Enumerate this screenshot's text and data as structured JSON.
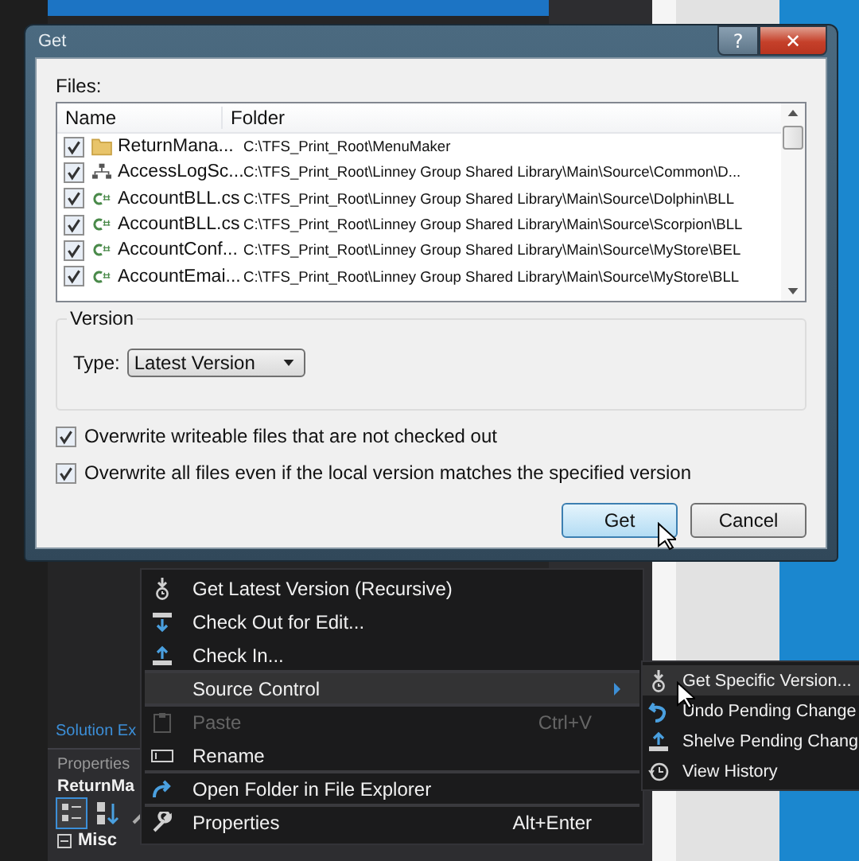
{
  "background": {
    "solution_tab": "Solution Ex",
    "properties_title": "Properties",
    "properties_object": "ReturnMa",
    "properties_category": "Misc"
  },
  "dialog": {
    "title": "Get",
    "help_button": "?",
    "close_button": "✕",
    "files_label": "Files:",
    "columns": [
      "Name",
      "Folder"
    ],
    "files": [
      {
        "name": "ReturnMana...",
        "folder": "C:\\TFS_Print_Root\\MenuMaker",
        "checked": true,
        "kind": "folder"
      },
      {
        "name": "AccessLogSc...",
        "folder": "C:\\TFS_Print_Root\\Linney Group Shared Library\\Main\\Source\\Common\\D...",
        "checked": true,
        "kind": "diagram"
      },
      {
        "name": "AccountBLL.cs",
        "folder": "C:\\TFS_Print_Root\\Linney Group Shared Library\\Main\\Source\\Dolphin\\BLL",
        "checked": true,
        "kind": "code"
      },
      {
        "name": "AccountBLL.cs",
        "folder": "C:\\TFS_Print_Root\\Linney Group Shared Library\\Main\\Source\\Scorpion\\BLL",
        "checked": true,
        "kind": "code"
      },
      {
        "name": "AccountConf...",
        "folder": "C:\\TFS_Print_Root\\Linney Group Shared Library\\Main\\Source\\MyStore\\BEL",
        "checked": true,
        "kind": "code"
      },
      {
        "name": "AccountEmai...",
        "folder": "C:\\TFS_Print_Root\\Linney Group Shared Library\\Main\\Source\\MyStore\\BLL",
        "checked": true,
        "kind": "code"
      }
    ],
    "version_group": "Version",
    "type_label": "Type:",
    "type_value": "Latest Version",
    "options": [
      {
        "label": "Overwrite writeable files that are not checked out",
        "checked": true
      },
      {
        "label": "Overwrite all files even if the local version matches the specified version",
        "checked": true
      }
    ],
    "buttons": [
      {
        "label": "Get",
        "selected": true
      },
      {
        "label": "Cancel",
        "selected": false
      }
    ]
  },
  "context_menu": {
    "items": [
      {
        "label": "Get Latest Version (Recursive)",
        "kind": "get",
        "selected": false,
        "disabled": false,
        "submenu": false
      },
      {
        "label": "Check Out for Edit...",
        "kind": "checkout",
        "selected": false,
        "disabled": false,
        "submenu": false
      },
      {
        "label": "Check In...",
        "kind": "checkin",
        "selected": false,
        "disabled": false,
        "submenu": false,
        "separator_after": true
      },
      {
        "label": "Source Control",
        "kind": "none",
        "selected": true,
        "disabled": false,
        "submenu": true,
        "separator_after": true
      },
      {
        "label": "Paste",
        "shortcut": "Ctrl+V",
        "kind": "paste",
        "selected": false,
        "disabled": true,
        "submenu": false
      },
      {
        "label": "Rename",
        "kind": "rename",
        "selected": false,
        "disabled": false,
        "submenu": false,
        "separator_after": true
      },
      {
        "label": "Open Folder in File Explorer",
        "kind": "open",
        "selected": false,
        "disabled": false,
        "submenu": false,
        "separator_after": true
      },
      {
        "label": "Properties",
        "shortcut": "Alt+Enter",
        "kind": "wrench",
        "selected": false,
        "disabled": false,
        "submenu": false
      }
    ]
  },
  "submenu": {
    "items": [
      {
        "label": "Get Specific Version...",
        "kind": "get",
        "selected": true
      },
      {
        "label": "Undo Pending Change",
        "kind": "undo",
        "selected": false
      },
      {
        "label": "Shelve Pending Chang",
        "kind": "checkin",
        "selected": false
      },
      {
        "label": "View History",
        "kind": "history",
        "selected": false
      }
    ]
  }
}
